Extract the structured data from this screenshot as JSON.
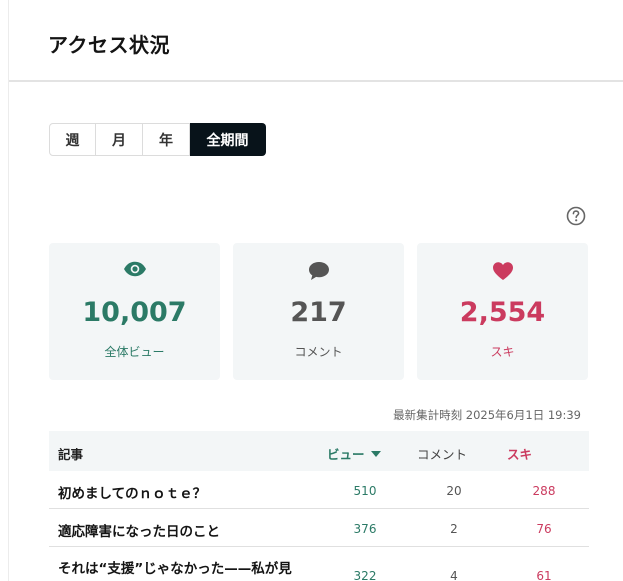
{
  "header": {
    "title": "アクセス状況"
  },
  "period_tabs": [
    {
      "label": "週",
      "active": false
    },
    {
      "label": "月",
      "active": false
    },
    {
      "label": "年",
      "active": false
    },
    {
      "label": "全期間",
      "active": true
    }
  ],
  "help": {
    "icon": "question-circle-icon"
  },
  "stats": {
    "views": {
      "value": "10,007",
      "label": "全体ビュー",
      "icon": "eye-icon",
      "color": "#2b7a66"
    },
    "comments": {
      "value": "217",
      "label": "コメント",
      "icon": "speech-bubble-icon",
      "color": "#555555"
    },
    "likes": {
      "value": "2,554",
      "label": "スキ",
      "icon": "heart-icon",
      "color": "#cb3b5f"
    }
  },
  "last_updated": "最新集計時刻 2025年6月1日 19:39",
  "table": {
    "headers": {
      "article": "記事",
      "views": "ビュー",
      "comments": "コメント",
      "likes": "スキ"
    },
    "sort_indicator": "caret-down-icon",
    "rows": [
      {
        "title": "初めましてのｎｏｔｅ？",
        "views": "510",
        "comments": "20",
        "likes": "288"
      },
      {
        "title": "適応障害になった日のこと",
        "views": "376",
        "comments": "2",
        "likes": "76"
      },
      {
        "title": "それは“支援”じゃなかった——私が見",
        "views": "322",
        "comments": "4",
        "likes": "61"
      }
    ]
  }
}
